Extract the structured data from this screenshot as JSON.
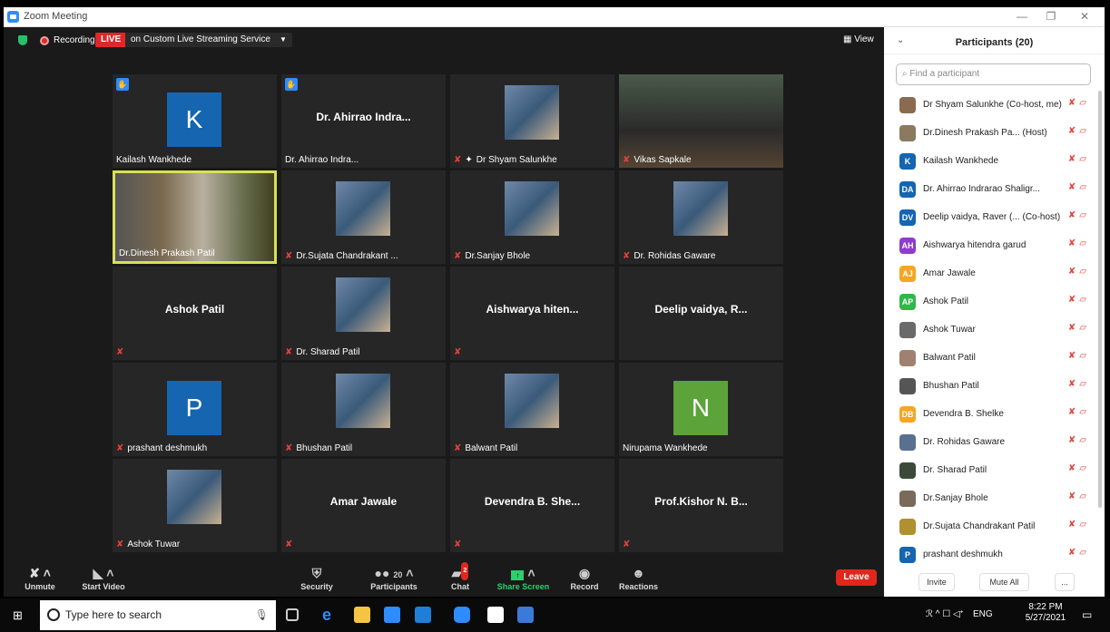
{
  "window": {
    "title": "Zoom Meeting"
  },
  "topbar": {
    "recording": "Recording",
    "live": "LIVE",
    "stream": "on Custom Live Streaming Service",
    "view": "View"
  },
  "tiles": [
    {
      "name": "Kailash Wankhede",
      "avatar": "K",
      "color": "#1565b0",
      "hand": true
    },
    {
      "name": "Dr. Ahirrao Indra...",
      "center": true,
      "hand": true
    },
    {
      "name": "Dr Shyam Salunkhe",
      "photo": true,
      "muted": true,
      "pin": true
    },
    {
      "name": "Vikas Sapkale",
      "video": true,
      "muted": true
    },
    {
      "name": "Dr.Dinesh Prakash Patil",
      "video": true,
      "active": true
    },
    {
      "name": "Dr.Sujata Chandrakant ...",
      "photo": true,
      "muted": true
    },
    {
      "name": "Dr.Sanjay Bhole",
      "photo": true,
      "muted": true
    },
    {
      "name": "Dr. Rohidas Gaware",
      "photo": true,
      "muted": true
    },
    {
      "name": "Ashok Patil",
      "center": true,
      "muted": true,
      "hidelabel": true
    },
    {
      "name": "Dr. Sharad Patil",
      "photo": true,
      "muted": true
    },
    {
      "name": "Aishwarya hiten...",
      "center": true,
      "muted": true,
      "hidelabel": true
    },
    {
      "name": "Deelip vaidya, R...",
      "center": true,
      "hidelabel": true
    },
    {
      "name": "prashant deshmukh",
      "avatar": "P",
      "color": "#1565b0",
      "muted": true
    },
    {
      "name": "Bhushan Patil",
      "photo": true,
      "muted": true
    },
    {
      "name": "Balwant Patil",
      "photo": true,
      "muted": true
    },
    {
      "name": "Nirupama Wankhede",
      "avatar": "N",
      "color": "#5ca33a"
    },
    {
      "name": "Ashok Tuwar",
      "photo": true,
      "muted": true
    },
    {
      "name": "Amar Jawale",
      "center": true,
      "muted": true,
      "hidelabel": true
    },
    {
      "name": "Devendra B. She...",
      "center": true,
      "muted": true,
      "hidelabel": true
    },
    {
      "name": "Prof.Kishor N. B...",
      "center": true,
      "muted": true,
      "hidelabel": true
    }
  ],
  "controls": {
    "unmute": "Unmute",
    "start_video": "Start Video",
    "security": "Security",
    "participants": "Participants",
    "participants_count": "20",
    "chat": "Chat",
    "chat_badge": "2",
    "share": "Share Screen",
    "record": "Record",
    "reactions": "Reactions",
    "leave": "Leave"
  },
  "panel": {
    "title": "Participants (20)",
    "search_placeholder": "Find a participant",
    "invite": "Invite",
    "mute_all": "Mute All",
    "more": "...",
    "participants": [
      {
        "name": "Dr Shyam Salunkhe (Co-host, me)",
        "initials": "",
        "color": "#8a6a50"
      },
      {
        "name": "Dr.Dinesh Prakash Pa... (Host)",
        "initials": "",
        "color": "#8a7a60"
      },
      {
        "name": "Kailash Wankhede",
        "initials": "K",
        "color": "#1565b0"
      },
      {
        "name": "Dr. Ahirrao Indrarao Shaligr...",
        "initials": "DA",
        "color": "#1565b0"
      },
      {
        "name": "Deelip vaidya, Raver (... (Co-host)",
        "initials": "DV",
        "color": "#1565b0"
      },
      {
        "name": "Aishwarya hitendra garud",
        "initials": "AH",
        "color": "#8e3cc9"
      },
      {
        "name": "Amar Jawale",
        "initials": "AJ",
        "color": "#f5a623"
      },
      {
        "name": "Ashok Patil",
        "initials": "AP",
        "color": "#2eb84a"
      },
      {
        "name": "Ashok Tuwar",
        "initials": "",
        "color": "#6a6a6a"
      },
      {
        "name": "Balwant Patil",
        "initials": "",
        "color": "#a08070"
      },
      {
        "name": "Bhushan Patil",
        "initials": "",
        "color": "#555"
      },
      {
        "name": "Devendra B. Shelke",
        "initials": "DB",
        "color": "#f5a623"
      },
      {
        "name": "Dr. Rohidas Gaware",
        "initials": "",
        "color": "#5a7090"
      },
      {
        "name": "Dr. Sharad Patil",
        "initials": "",
        "color": "#3a4a3a"
      },
      {
        "name": "Dr.Sanjay Bhole",
        "initials": "",
        "color": "#7a6a5a"
      },
      {
        "name": "Dr.Sujata Chandrakant Patil",
        "initials": "",
        "color": "#b09030"
      },
      {
        "name": "prashant deshmukh",
        "initials": "P",
        "color": "#1565b0"
      }
    ]
  },
  "taskbar": {
    "search": "Type here to search",
    "lang": "ENG",
    "time": "8:22 PM",
    "date": "5/27/2021"
  }
}
